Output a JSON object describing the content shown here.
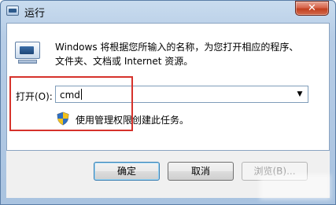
{
  "window": {
    "title": "运行",
    "close_label": "✕"
  },
  "main": {
    "description_line1": "Windows 将根据您所输入的名称，为您打开相应的程序、",
    "description_line2": "文件夹、文档或 Internet 资源。",
    "open_label": "打开(O):",
    "combo_value": "cmd",
    "combo_arrow": "▼",
    "admin_note": "使用管理权限创建此任务。"
  },
  "buttons": {
    "ok": "确定",
    "cancel": "取消",
    "browse": "浏览(B)..."
  },
  "icons": {
    "title": "run-icon",
    "main": "run-dialog-icon",
    "shield": "uac-shield-icon"
  },
  "colors": {
    "highlight": "#d6322b",
    "close_button": "#c2401f",
    "frame": "#a9c3e0"
  }
}
